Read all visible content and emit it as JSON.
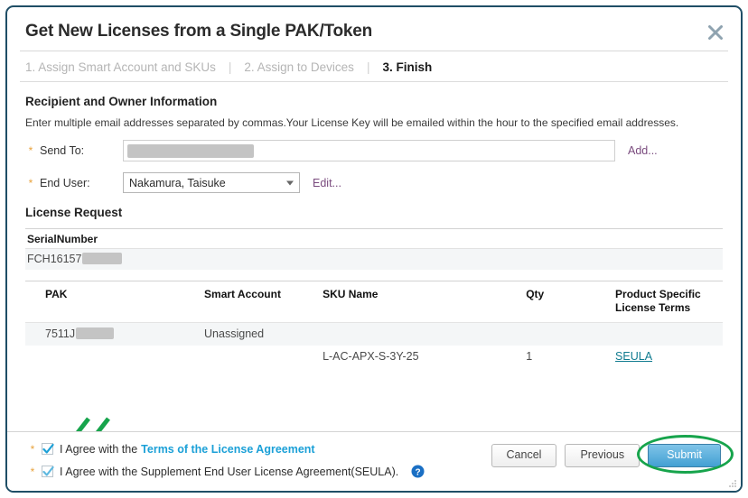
{
  "dialog": {
    "title": "Get New Licenses from a Single PAK/Token",
    "close_icon": "close-icon"
  },
  "steps": [
    {
      "label": "1. Assign Smart Account and SKUs",
      "active": false
    },
    {
      "label": "2. Assign to Devices",
      "active": false
    },
    {
      "label": "3. Finish",
      "active": true
    }
  ],
  "step_separator": "|",
  "recipient": {
    "section_title": "Recipient and Owner Information",
    "description": "Enter multiple email addresses separated by commas.Your License Key will be emailed within the hour to the specified email addresses.",
    "send_to": {
      "label": "Send To:",
      "required_marker": "*",
      "value": "",
      "placeholder": "",
      "redacted": true,
      "add_link": "Add..."
    },
    "end_user": {
      "label": "End User:",
      "required_marker": "*",
      "selected": "Nakamura, Taisuke",
      "edit_link": "Edit..."
    }
  },
  "license_request": {
    "section_title": "License Request",
    "serial_header": "SerialNumber",
    "serial_value": "FCH16157",
    "serial_redacted": true,
    "columns": [
      "PAK",
      "Smart Account",
      "SKU Name",
      "Qty",
      "Product Specific License Terms"
    ],
    "rows": [
      {
        "pak": "7511J",
        "pak_redacted": true,
        "smart_account": "Unassigned",
        "sku_name": "",
        "qty": "",
        "terms": "",
        "shaded": true
      },
      {
        "pak": "",
        "pak_redacted": false,
        "smart_account": "",
        "sku_name": "L-AC-APX-S-3Y-25",
        "qty": "1",
        "terms": "SEULA",
        "shaded": false
      }
    ]
  },
  "footer": {
    "agreements": [
      {
        "required_marker": "*",
        "checked": true,
        "text_before": "I Agree with the",
        "link_text": "Terms of the License Agreement",
        "text_after": ""
      },
      {
        "required_marker": "*",
        "checked": true,
        "text_before": "I Agree with the Supplement End User License Agreement(SEULA).",
        "link_text": "",
        "text_after": ""
      }
    ],
    "help_icon": "help-circle-icon",
    "buttons": {
      "cancel": "Cancel",
      "previous": "Previous",
      "submit": "Submit"
    }
  },
  "annotations": {
    "arrow_color": "#17a44c",
    "highlight_color": "#17a44c",
    "arrow_count": 2,
    "arrow_target": "agreement-checkboxes",
    "ellipse_target": "submit-button"
  },
  "colors": {
    "dialog_border": "#1f4e66",
    "link_cyan": "#1ba0d7",
    "link_purple": "#7a4b7e",
    "link_teal": "#0f7b8f",
    "required_star": "#e8a33d",
    "submit_blue": "#43a0d3",
    "annotation_green": "#17a44c"
  }
}
